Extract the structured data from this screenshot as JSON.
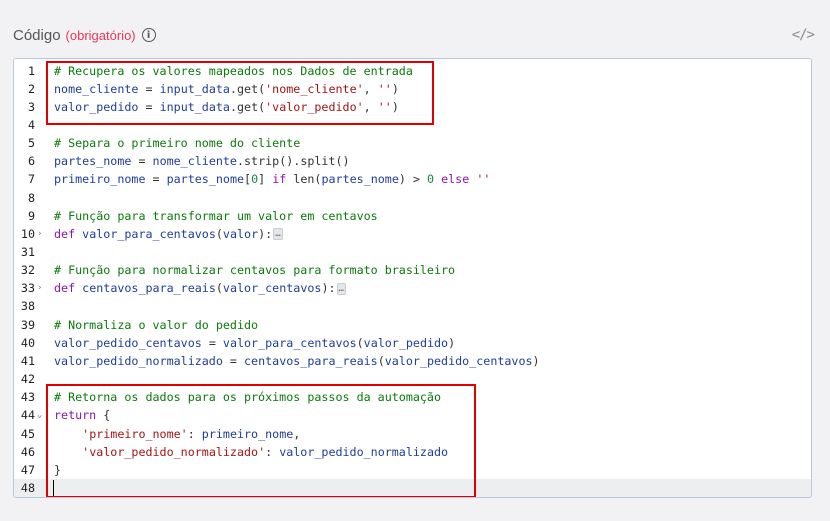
{
  "header": {
    "label": "Código",
    "required": "(obrigatório)",
    "info_icon": "info-icon",
    "toggle": "</>"
  },
  "highlight_color": "#e00000",
  "editor": {
    "active_line": "48",
    "lines": [
      {
        "n": "1",
        "fold": "",
        "tokens": [
          {
            "t": "c",
            "v": "# Recupera os valores mapeados nos Dados de entrada"
          }
        ]
      },
      {
        "n": "2",
        "fold": "",
        "tokens": [
          {
            "t": "vr",
            "v": "nome_cliente"
          },
          {
            "t": "pl",
            "v": " = "
          },
          {
            "t": "vr",
            "v": "input_data"
          },
          {
            "t": "pl",
            "v": ".get("
          },
          {
            "t": "st",
            "v": "'nome_cliente'"
          },
          {
            "t": "pl",
            "v": ", "
          },
          {
            "t": "st",
            "v": "''"
          },
          {
            "t": "pl",
            "v": ")"
          }
        ]
      },
      {
        "n": "3",
        "fold": "",
        "tokens": [
          {
            "t": "vr",
            "v": "valor_pedido"
          },
          {
            "t": "pl",
            "v": " = "
          },
          {
            "t": "vr",
            "v": "input_data"
          },
          {
            "t": "pl",
            "v": ".get("
          },
          {
            "t": "st",
            "v": "'valor_pedido'"
          },
          {
            "t": "pl",
            "v": ", "
          },
          {
            "t": "st",
            "v": "''"
          },
          {
            "t": "pl",
            "v": ")"
          }
        ]
      },
      {
        "n": "4",
        "fold": "",
        "tokens": []
      },
      {
        "n": "5",
        "fold": "",
        "tokens": [
          {
            "t": "c",
            "v": "# Separa o primeiro nome do cliente"
          }
        ]
      },
      {
        "n": "6",
        "fold": "",
        "tokens": [
          {
            "t": "vr",
            "v": "partes_nome"
          },
          {
            "t": "pl",
            "v": " = "
          },
          {
            "t": "vr",
            "v": "nome_cliente"
          },
          {
            "t": "pl",
            "v": ".strip().split()"
          }
        ]
      },
      {
        "n": "7",
        "fold": "",
        "tokens": [
          {
            "t": "vr",
            "v": "primeiro_nome"
          },
          {
            "t": "pl",
            "v": " = "
          },
          {
            "t": "vr",
            "v": "partes_nome"
          },
          {
            "t": "pl",
            "v": "["
          },
          {
            "t": "nu",
            "v": "0"
          },
          {
            "t": "pl",
            "v": "] "
          },
          {
            "t": "kw",
            "v": "if"
          },
          {
            "t": "pl",
            "v": " len("
          },
          {
            "t": "vr",
            "v": "partes_nome"
          },
          {
            "t": "pl",
            "v": ") > "
          },
          {
            "t": "nu",
            "v": "0"
          },
          {
            "t": "pl",
            "v": " "
          },
          {
            "t": "kw",
            "v": "else"
          },
          {
            "t": "pl",
            "v": " "
          },
          {
            "t": "st",
            "v": "''"
          }
        ]
      },
      {
        "n": "8",
        "fold": "",
        "tokens": []
      },
      {
        "n": "9",
        "fold": "",
        "tokens": [
          {
            "t": "c",
            "v": "# Função para transformar um valor em centavos"
          }
        ]
      },
      {
        "n": "10",
        "fold": "›",
        "tokens": [
          {
            "t": "kw",
            "v": "def"
          },
          {
            "t": "pl",
            "v": " "
          },
          {
            "t": "vr",
            "v": "valor_para_centavos"
          },
          {
            "t": "pl",
            "v": "("
          },
          {
            "t": "vr",
            "v": "valor"
          },
          {
            "t": "pl",
            "v": "):"
          },
          {
            "t": "ellipsis",
            "v": "…"
          }
        ]
      },
      {
        "n": "31",
        "fold": "",
        "tokens": []
      },
      {
        "n": "32",
        "fold": "",
        "tokens": [
          {
            "t": "c",
            "v": "# Função para normalizar centavos para formato brasileiro"
          }
        ]
      },
      {
        "n": "33",
        "fold": "›",
        "tokens": [
          {
            "t": "kw",
            "v": "def"
          },
          {
            "t": "pl",
            "v": " "
          },
          {
            "t": "vr",
            "v": "centavos_para_reais"
          },
          {
            "t": "pl",
            "v": "("
          },
          {
            "t": "vr",
            "v": "valor_centavos"
          },
          {
            "t": "pl",
            "v": "):"
          },
          {
            "t": "ellipsis",
            "v": "…"
          }
        ]
      },
      {
        "n": "38",
        "fold": "",
        "tokens": []
      },
      {
        "n": "39",
        "fold": "",
        "tokens": [
          {
            "t": "c",
            "v": "# Normaliza o valor do pedido"
          }
        ]
      },
      {
        "n": "40",
        "fold": "",
        "tokens": [
          {
            "t": "vr",
            "v": "valor_pedido_centavos"
          },
          {
            "t": "pl",
            "v": " = "
          },
          {
            "t": "vr",
            "v": "valor_para_centavos"
          },
          {
            "t": "pl",
            "v": "("
          },
          {
            "t": "vr",
            "v": "valor_pedido"
          },
          {
            "t": "pl",
            "v": ")"
          }
        ]
      },
      {
        "n": "41",
        "fold": "",
        "tokens": [
          {
            "t": "vr",
            "v": "valor_pedido_normalizado"
          },
          {
            "t": "pl",
            "v": " = "
          },
          {
            "t": "vr",
            "v": "centavos_para_reais"
          },
          {
            "t": "pl",
            "v": "("
          },
          {
            "t": "vr",
            "v": "valor_pedido_centavos"
          },
          {
            "t": "pl",
            "v": ")"
          }
        ]
      },
      {
        "n": "42",
        "fold": "",
        "tokens": []
      },
      {
        "n": "43",
        "fold": "",
        "tokens": [
          {
            "t": "c",
            "v": "# Retorna os dados para os próximos passos da automação"
          }
        ]
      },
      {
        "n": "44",
        "fold": "⌄",
        "tokens": [
          {
            "t": "kw",
            "v": "return"
          },
          {
            "t": "pl",
            "v": " {"
          }
        ]
      },
      {
        "n": "45",
        "fold": "",
        "tokens": [
          {
            "t": "pl",
            "v": "    "
          },
          {
            "t": "st",
            "v": "'primeiro_nome'"
          },
          {
            "t": "pl",
            "v": ": "
          },
          {
            "t": "vr",
            "v": "primeiro_nome"
          },
          {
            "t": "pl",
            "v": ","
          }
        ]
      },
      {
        "n": "46",
        "fold": "",
        "tokens": [
          {
            "t": "pl",
            "v": "    "
          },
          {
            "t": "st",
            "v": "'valor_pedido_normalizado'"
          },
          {
            "t": "pl",
            "v": ": "
          },
          {
            "t": "vr",
            "v": "valor_pedido_normalizado"
          }
        ]
      },
      {
        "n": "47",
        "fold": "",
        "tokens": [
          {
            "t": "pl",
            "v": "}"
          }
        ]
      },
      {
        "n": "48",
        "fold": "",
        "tokens": []
      }
    ]
  }
}
